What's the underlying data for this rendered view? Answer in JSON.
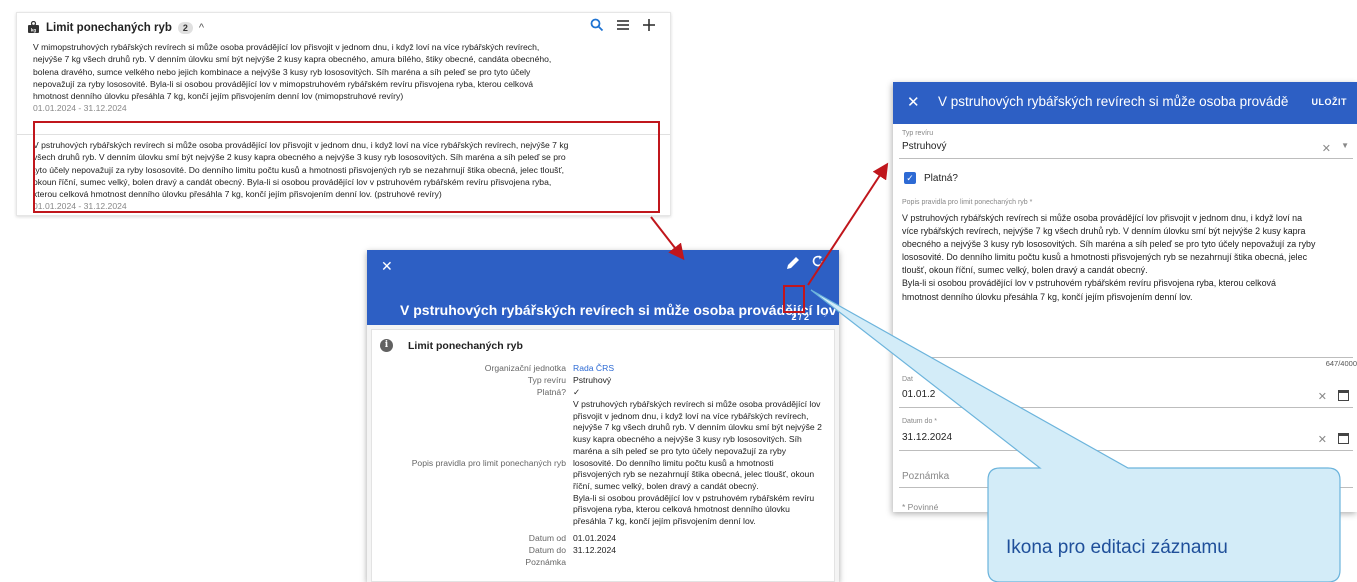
{
  "list_panel": {
    "title": "Limit ponechaných ryb",
    "count": "2",
    "records": [
      {
        "lines": [
          "V mimopstruhových rybářských revírech si může osoba provádějící lov přisvojit v jednom dnu, i když loví na více rybářských revírech,",
          "nejvýše 7 kg všech druhů ryb. V denním úlovku smí být nejvýše 2 kusy kapra obecného, amura bílého, štiky obecné, candáta obecného,",
          "bolena dravého, sumce velkého nebo jejich kombinace a nejvýše 3 kusy ryb lososovitých. Síh maréna a síh peleď se pro tyto účely",
          "nepovažují za ryby lososovité. Byla-li si osobou provádějící lov v mimopstruhovém rybářském revíru přisvojena ryba, kterou celková",
          "hmotnost denního úlovku přesáhla 7 kg, končí jejím přisvojením denní lov (mimopstruhové revíry)"
        ],
        "date": "01.01.2024 - 31.12.2024"
      },
      {
        "lines": [
          "V pstruhových rybářských revírech si může osoba provádějící lov přisvojit v jednom dnu, i když loví na více rybářských revírech, nejvýše 7 kg",
          "všech druhů ryb. V denním úlovku smí být nejvýše 2 kusy kapra obecného a nejvýše 3 kusy ryb lososovitých. Síh maréna a síh peleď se pro",
          "tyto účely nepovažují za ryby lososovité. Do denního limitu počtu kusů a hmotnosti přisvojených ryb se nezahrnují štika obecná, jelec tloušť,",
          "okoun říční, sumec velký, bolen dravý a candát obecný. Byla-li si osobou provádějící lov v pstruhovém rybářském revíru přisvojena ryba,",
          "kterou celková hmotnost denního úlovku přesáhla 7 kg, končí jejím přisvojením denní lov. (pstruhové revíry)"
        ],
        "date": "01.01.2024 - 31.12.2024"
      }
    ]
  },
  "detail_dialog": {
    "title": "V pstruhových rybářských revírech si může osoba provádějící lov při...",
    "pager": "2 / 2",
    "section_title": "Limit ponechaných ryb",
    "fields": {
      "org_label": "Organizační jednotka",
      "org_value": "Rada ČRS",
      "type_label": "Typ revíru",
      "type_value": "Pstruhový",
      "valid_label": "Platná?",
      "valid_value": "✓",
      "desc_label": "Popis pravidla pro limit ponechaných ryb",
      "desc_lines": [
        "V  pstruhových rybářských revírech si může osoba provádějící lov",
        "přisvojit v jednom dnu, i když loví na více rybářských revírech,",
        "nejvýše 7 kg všech druhů ryb. V denním úlovku smí být nejvýše 2",
        "kusy kapra obecného a nejvýše 3 kusy ryb lososovitých. Síh",
        "maréna a síh peleď se pro tyto účely nepovažují za ryby",
        "lososovité. Do denního limitu počtu kusů a  hmotnosti",
        "přisvojených ryb se nezahrnují štika obecná, jelec tloušť, okoun",
        "říční, sumec velký, bolen dravý a candát obecný.",
        "Byla-li si osobou provádějící lov v  pstruhovém rybářském revíru",
        "přisvojena ryba, kterou celková hmotnost denního úlovku",
        "přesáhla 7 kg, končí jejím přisvojením denní lov."
      ],
      "date_from_label": "Datum od",
      "date_from_value": "01.01.2024",
      "date_to_label": "Datum do",
      "date_to_value": "31.12.2024",
      "note_label": "Poznámka"
    }
  },
  "edit_form": {
    "title": "V pstruhových rybářských revírech si může osoba provádějící lov při",
    "save_label": "ULOŽIT",
    "type_label": "Typ revíru",
    "type_value": "Pstruhový",
    "valid_label": "Platná?",
    "desc_label": "Popis pravidla pro limit ponechaných ryb *",
    "desc_lines": [
      "V  pstruhových rybářských revírech si může osoba provádějící lov přisvojit v jednom dnu, i když loví na",
      "více rybářských revírech, nejvýše 7 kg všech druhů ryb. V denním úlovku smí být nejvýše 2 kusy kapra",
      "obecného a nejvýše 3 kusy ryb lososovitých. Síh maréna a síh peleď se pro tyto účely nepovažují za ryby",
      "lososovité. Do denního limitu počtu kusů a  hmotnosti přisvojených ryb se nezahrnují štika obecná, jelec",
      "tloušť, okoun říční, sumec velký, bolen dravý a candát obecný.",
      "Byla-li si osobou provádějící lov v  pstruhovém rybářském revíru přisvojena ryba, kterou celková",
      "hmotnost denního úlovku přesáhla 7 kg, končí jejím přisvojením denní lov."
    ],
    "counter": "647/4000",
    "date_from_label": "Dat",
    "date_from_value": "01.01.2",
    "date_to_label": "Datum do *",
    "date_to_value": "31.12.2024",
    "note_placeholder": "Poznámka",
    "required_note": "* Povinné"
  },
  "callout": {
    "text": "Ikona pro editaci záznamu"
  },
  "colors": {
    "primary_blue": "#2d5fc4",
    "highlight_red": "#c0161c",
    "callout_fill": "#d3ecf8",
    "callout_border": "#6cb4dc",
    "callout_text": "#1f4f9a"
  }
}
